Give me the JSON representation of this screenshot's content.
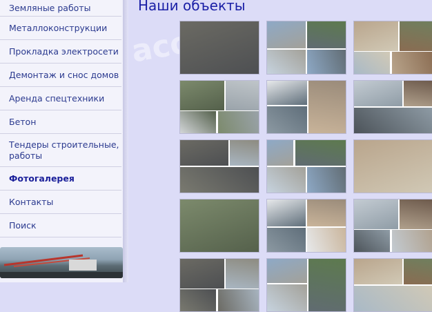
{
  "menu": {
    "items": [
      {
        "label": "Земляные работы",
        "name": "menu-item-earthworks"
      },
      {
        "label": "Металлоконструкции",
        "name": "menu-item-metal-structures"
      },
      {
        "label": "Прокладка электросети",
        "name": "menu-item-power-grid"
      },
      {
        "label": "Демонтаж и снос домов",
        "name": "menu-item-demolition"
      },
      {
        "label": "Аренда спецтехники",
        "name": "menu-item-equipment-rental"
      },
      {
        "label": "Бетон",
        "name": "menu-item-concrete"
      },
      {
        "label": "Тендеры строительные, работы",
        "name": "menu-item-tenders"
      },
      {
        "label": "Фотогалерея",
        "name": "menu-item-photo-gallery"
      },
      {
        "label": "Контакты",
        "name": "menu-item-contacts"
      },
      {
        "label": "Поиск",
        "name": "menu-item-search"
      }
    ]
  },
  "page": {
    "title": "Наши объекты",
    "watermark": "acoola"
  },
  "gallery": {
    "columns": 3,
    "rows": 6
  }
}
